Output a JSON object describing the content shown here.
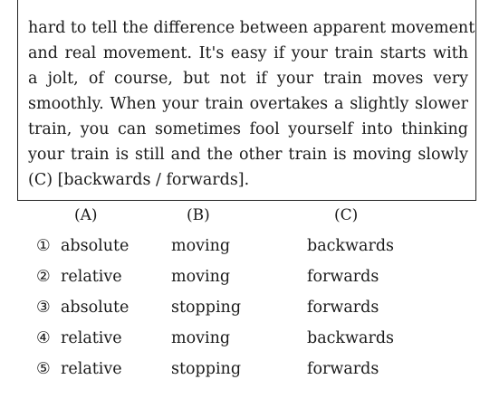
{
  "passage": {
    "lines": [
      "hard to tell the difference between apparent movement",
      "and real movement. It's easy if your train starts with",
      "a jolt, of course, but not if your train moves very",
      "smoothly. When your train overtakes a slightly slower",
      "train, you can sometimes fool yourself into thinking",
      "your train is still and the other train is moving slowly",
      "(C) [backwards / forwards]."
    ]
  },
  "columns": {
    "a": "(A)",
    "b": "(B)",
    "c": "(C)"
  },
  "options": [
    {
      "number": "①",
      "a": "absolute",
      "b": "moving",
      "c": "backwards"
    },
    {
      "number": "②",
      "a": "relative",
      "b": "moving",
      "c": "forwards"
    },
    {
      "number": "③",
      "a": "absolute",
      "b": "stopping",
      "c": "forwards"
    },
    {
      "number": "④",
      "a": "relative",
      "b": "moving",
      "c": "backwards"
    },
    {
      "number": "⑤",
      "a": "relative",
      "b": "stopping",
      "c": "forwards"
    }
  ]
}
